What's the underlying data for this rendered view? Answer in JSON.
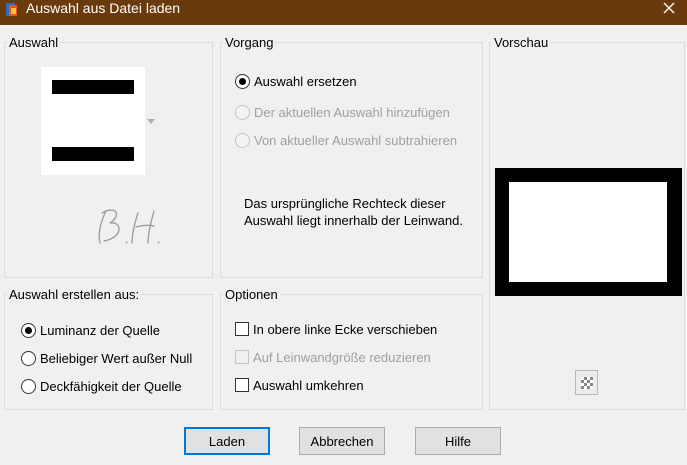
{
  "window": {
    "title": "Auswahl aus Datei laden"
  },
  "auswahl": {
    "legend": "Auswahl"
  },
  "vorgang": {
    "legend": "Vorgang",
    "options": [
      {
        "label": "Auswahl ersetzen",
        "selected": true,
        "enabled": true
      },
      {
        "label": "Der aktuellen Auswahl hinzufügen",
        "selected": false,
        "enabled": false
      },
      {
        "label": "Von aktueller Auswahl subtrahieren",
        "selected": false,
        "enabled": false
      }
    ],
    "info": "Das ursprüngliche Rechteck dieser Auswahl liegt innerhalb der Leinwand."
  },
  "vorschau": {
    "legend": "Vorschau"
  },
  "quelle": {
    "legend": "Auswahl erstellen aus:",
    "options": [
      {
        "label": "Luminanz der Quelle",
        "selected": true
      },
      {
        "label": "Beliebiger Wert außer Null",
        "selected": false
      },
      {
        "label": "Deckfähigkeit der Quelle",
        "selected": false
      }
    ]
  },
  "optionen": {
    "legend": "Optionen",
    "items": [
      {
        "label": "In obere linke Ecke verschieben",
        "checked": false,
        "enabled": true
      },
      {
        "label": "Auf Leinwandgröße reduzieren",
        "checked": false,
        "enabled": false
      },
      {
        "label": "Auswahl umkehren",
        "checked": false,
        "enabled": true
      }
    ]
  },
  "buttons": {
    "load": "Laden",
    "cancel": "Abbrechen",
    "help": "Hilfe"
  },
  "colors": {
    "titlebar": "#6b3a0c",
    "accent": "#0078d7"
  }
}
